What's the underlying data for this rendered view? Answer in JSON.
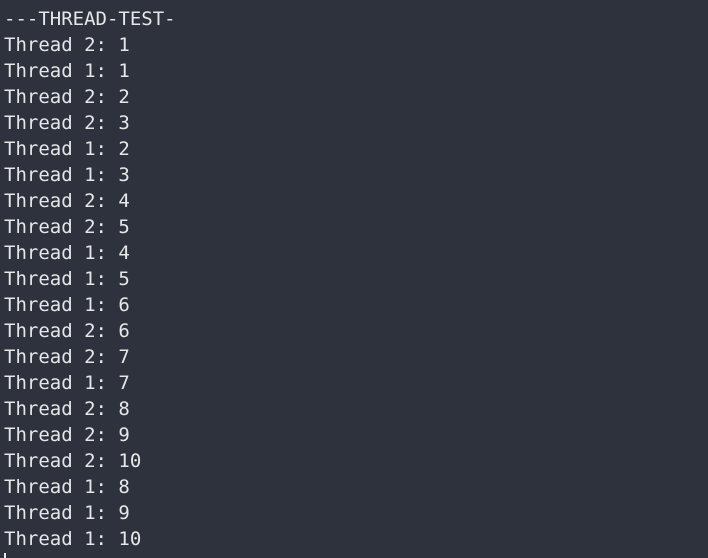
{
  "terminal": {
    "header": "---THREAD-TEST-",
    "lines": [
      "Thread 2: 1",
      "Thread 1: 1",
      "Thread 2: 2",
      "Thread 2: 3",
      "Thread 1: 2",
      "Thread 1: 3",
      "Thread 2: 4",
      "Thread 2: 5",
      "Thread 1: 4",
      "Thread 1: 5",
      "Thread 1: 6",
      "Thread 2: 6",
      "Thread 2: 7",
      "Thread 1: 7",
      "Thread 2: 8",
      "Thread 2: 9",
      "Thread 2: 10",
      "Thread 1: 8",
      "Thread 1: 9",
      "Thread 1: 10"
    ]
  },
  "colors": {
    "background": "#2e323d",
    "text": "#e6e7ea"
  }
}
